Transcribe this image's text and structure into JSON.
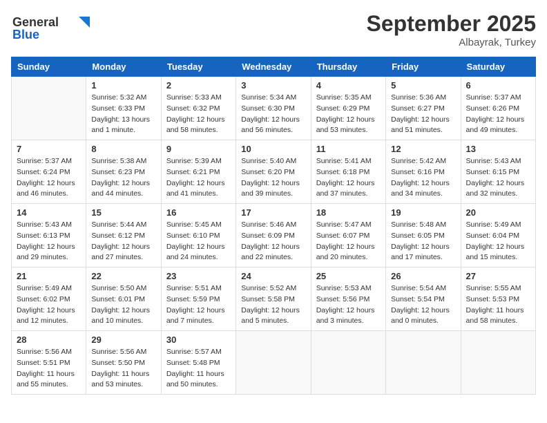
{
  "header": {
    "logo_general": "General",
    "logo_blue": "Blue",
    "month": "September 2025",
    "location": "Albayrak, Turkey"
  },
  "weekdays": [
    "Sunday",
    "Monday",
    "Tuesday",
    "Wednesday",
    "Thursday",
    "Friday",
    "Saturday"
  ],
  "weeks": [
    [
      {
        "day": "",
        "empty": true
      },
      {
        "day": "1",
        "sunrise": "Sunrise: 5:32 AM",
        "sunset": "Sunset: 6:33 PM",
        "daylight": "Daylight: 13 hours and 1 minute."
      },
      {
        "day": "2",
        "sunrise": "Sunrise: 5:33 AM",
        "sunset": "Sunset: 6:32 PM",
        "daylight": "Daylight: 12 hours and 58 minutes."
      },
      {
        "day": "3",
        "sunrise": "Sunrise: 5:34 AM",
        "sunset": "Sunset: 6:30 PM",
        "daylight": "Daylight: 12 hours and 56 minutes."
      },
      {
        "day": "4",
        "sunrise": "Sunrise: 5:35 AM",
        "sunset": "Sunset: 6:29 PM",
        "daylight": "Daylight: 12 hours and 53 minutes."
      },
      {
        "day": "5",
        "sunrise": "Sunrise: 5:36 AM",
        "sunset": "Sunset: 6:27 PM",
        "daylight": "Daylight: 12 hours and 51 minutes."
      },
      {
        "day": "6",
        "sunrise": "Sunrise: 5:37 AM",
        "sunset": "Sunset: 6:26 PM",
        "daylight": "Daylight: 12 hours and 49 minutes."
      }
    ],
    [
      {
        "day": "7",
        "sunrise": "Sunrise: 5:37 AM",
        "sunset": "Sunset: 6:24 PM",
        "daylight": "Daylight: 12 hours and 46 minutes."
      },
      {
        "day": "8",
        "sunrise": "Sunrise: 5:38 AM",
        "sunset": "Sunset: 6:23 PM",
        "daylight": "Daylight: 12 hours and 44 minutes."
      },
      {
        "day": "9",
        "sunrise": "Sunrise: 5:39 AM",
        "sunset": "Sunset: 6:21 PM",
        "daylight": "Daylight: 12 hours and 41 minutes."
      },
      {
        "day": "10",
        "sunrise": "Sunrise: 5:40 AM",
        "sunset": "Sunset: 6:20 PM",
        "daylight": "Daylight: 12 hours and 39 minutes."
      },
      {
        "day": "11",
        "sunrise": "Sunrise: 5:41 AM",
        "sunset": "Sunset: 6:18 PM",
        "daylight": "Daylight: 12 hours and 37 minutes."
      },
      {
        "day": "12",
        "sunrise": "Sunrise: 5:42 AM",
        "sunset": "Sunset: 6:16 PM",
        "daylight": "Daylight: 12 hours and 34 minutes."
      },
      {
        "day": "13",
        "sunrise": "Sunrise: 5:43 AM",
        "sunset": "Sunset: 6:15 PM",
        "daylight": "Daylight: 12 hours and 32 minutes."
      }
    ],
    [
      {
        "day": "14",
        "sunrise": "Sunrise: 5:43 AM",
        "sunset": "Sunset: 6:13 PM",
        "daylight": "Daylight: 12 hours and 29 minutes."
      },
      {
        "day": "15",
        "sunrise": "Sunrise: 5:44 AM",
        "sunset": "Sunset: 6:12 PM",
        "daylight": "Daylight: 12 hours and 27 minutes."
      },
      {
        "day": "16",
        "sunrise": "Sunrise: 5:45 AM",
        "sunset": "Sunset: 6:10 PM",
        "daylight": "Daylight: 12 hours and 24 minutes."
      },
      {
        "day": "17",
        "sunrise": "Sunrise: 5:46 AM",
        "sunset": "Sunset: 6:09 PM",
        "daylight": "Daylight: 12 hours and 22 minutes."
      },
      {
        "day": "18",
        "sunrise": "Sunrise: 5:47 AM",
        "sunset": "Sunset: 6:07 PM",
        "daylight": "Daylight: 12 hours and 20 minutes."
      },
      {
        "day": "19",
        "sunrise": "Sunrise: 5:48 AM",
        "sunset": "Sunset: 6:05 PM",
        "daylight": "Daylight: 12 hours and 17 minutes."
      },
      {
        "day": "20",
        "sunrise": "Sunrise: 5:49 AM",
        "sunset": "Sunset: 6:04 PM",
        "daylight": "Daylight: 12 hours and 15 minutes."
      }
    ],
    [
      {
        "day": "21",
        "sunrise": "Sunrise: 5:49 AM",
        "sunset": "Sunset: 6:02 PM",
        "daylight": "Daylight: 12 hours and 12 minutes."
      },
      {
        "day": "22",
        "sunrise": "Sunrise: 5:50 AM",
        "sunset": "Sunset: 6:01 PM",
        "daylight": "Daylight: 12 hours and 10 minutes."
      },
      {
        "day": "23",
        "sunrise": "Sunrise: 5:51 AM",
        "sunset": "Sunset: 5:59 PM",
        "daylight": "Daylight: 12 hours and 7 minutes."
      },
      {
        "day": "24",
        "sunrise": "Sunrise: 5:52 AM",
        "sunset": "Sunset: 5:58 PM",
        "daylight": "Daylight: 12 hours and 5 minutes."
      },
      {
        "day": "25",
        "sunrise": "Sunrise: 5:53 AM",
        "sunset": "Sunset: 5:56 PM",
        "daylight": "Daylight: 12 hours and 3 minutes."
      },
      {
        "day": "26",
        "sunrise": "Sunrise: 5:54 AM",
        "sunset": "Sunset: 5:54 PM",
        "daylight": "Daylight: 12 hours and 0 minutes."
      },
      {
        "day": "27",
        "sunrise": "Sunrise: 5:55 AM",
        "sunset": "Sunset: 5:53 PM",
        "daylight": "Daylight: 11 hours and 58 minutes."
      }
    ],
    [
      {
        "day": "28",
        "sunrise": "Sunrise: 5:56 AM",
        "sunset": "Sunset: 5:51 PM",
        "daylight": "Daylight: 11 hours and 55 minutes."
      },
      {
        "day": "29",
        "sunrise": "Sunrise: 5:56 AM",
        "sunset": "Sunset: 5:50 PM",
        "daylight": "Daylight: 11 hours and 53 minutes."
      },
      {
        "day": "30",
        "sunrise": "Sunrise: 5:57 AM",
        "sunset": "Sunset: 5:48 PM",
        "daylight": "Daylight: 11 hours and 50 minutes."
      },
      {
        "day": "",
        "empty": true
      },
      {
        "day": "",
        "empty": true
      },
      {
        "day": "",
        "empty": true
      },
      {
        "day": "",
        "empty": true
      }
    ]
  ]
}
